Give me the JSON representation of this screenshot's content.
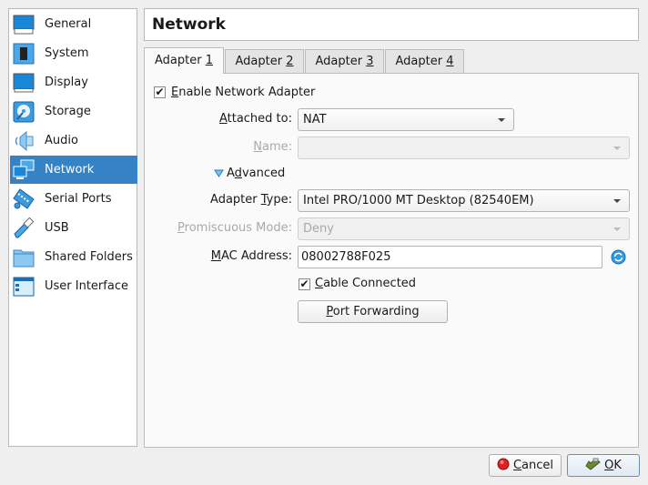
{
  "sidebar": {
    "items": [
      {
        "label": "General",
        "icon": "general-icon",
        "active": false
      },
      {
        "label": "System",
        "icon": "chip-icon",
        "active": false
      },
      {
        "label": "Display",
        "icon": "monitor-icon",
        "active": false
      },
      {
        "label": "Storage",
        "icon": "disk-icon",
        "active": false
      },
      {
        "label": "Audio",
        "icon": "speaker-icon",
        "active": false
      },
      {
        "label": "Network",
        "icon": "network-icon",
        "active": true
      },
      {
        "label": "Serial Ports",
        "icon": "serial-port-icon",
        "active": false
      },
      {
        "label": "USB",
        "icon": "usb-icon",
        "active": false
      },
      {
        "label": "Shared Folders",
        "icon": "folder-icon",
        "active": false
      },
      {
        "label": "User Interface",
        "icon": "window-icon",
        "active": false
      }
    ]
  },
  "header": {
    "title": "Network"
  },
  "tabs": [
    {
      "prefix": "Adapter ",
      "mnemonic": "1",
      "active": true
    },
    {
      "prefix": "Adapter ",
      "mnemonic": "2",
      "active": false
    },
    {
      "prefix": "Adapter ",
      "mnemonic": "3",
      "active": false
    },
    {
      "prefix": "Adapter ",
      "mnemonic": "4",
      "active": false
    }
  ],
  "form": {
    "enable_adapter": {
      "mnemonic": "E",
      "rest": "nable Network Adapter",
      "checked": true
    },
    "attached_to": {
      "mnemonic": "A",
      "rest": "ttached to:",
      "value": "NAT"
    },
    "name": {
      "mnemonic": "N",
      "rest": "ame:",
      "value": "",
      "disabled": true
    },
    "advanced": {
      "pre": "A",
      "mnemonic": "d",
      "rest": "vanced",
      "expanded": true
    },
    "adapter_type": {
      "pre": "Adapter ",
      "mnemonic": "T",
      "rest": "ype:",
      "value": "Intel PRO/1000 MT Desktop (82540EM)"
    },
    "promiscuous_mode": {
      "mnemonic": "P",
      "rest": "romiscuous Mode:",
      "value": "Deny",
      "disabled": true
    },
    "mac_address": {
      "mnemonic": "M",
      "rest": "AC Address:",
      "value": "08002788F025"
    },
    "cable_connected": {
      "mnemonic": "C",
      "rest": "able Connected",
      "checked": true
    },
    "port_forwarding": {
      "mnemonic": "P",
      "rest": "ort Forwarding"
    }
  },
  "footer": {
    "cancel": {
      "mnemonic": "C",
      "rest": "ancel"
    },
    "ok": {
      "mnemonic": "O",
      "rest": "K"
    }
  },
  "checkmark": "✔"
}
